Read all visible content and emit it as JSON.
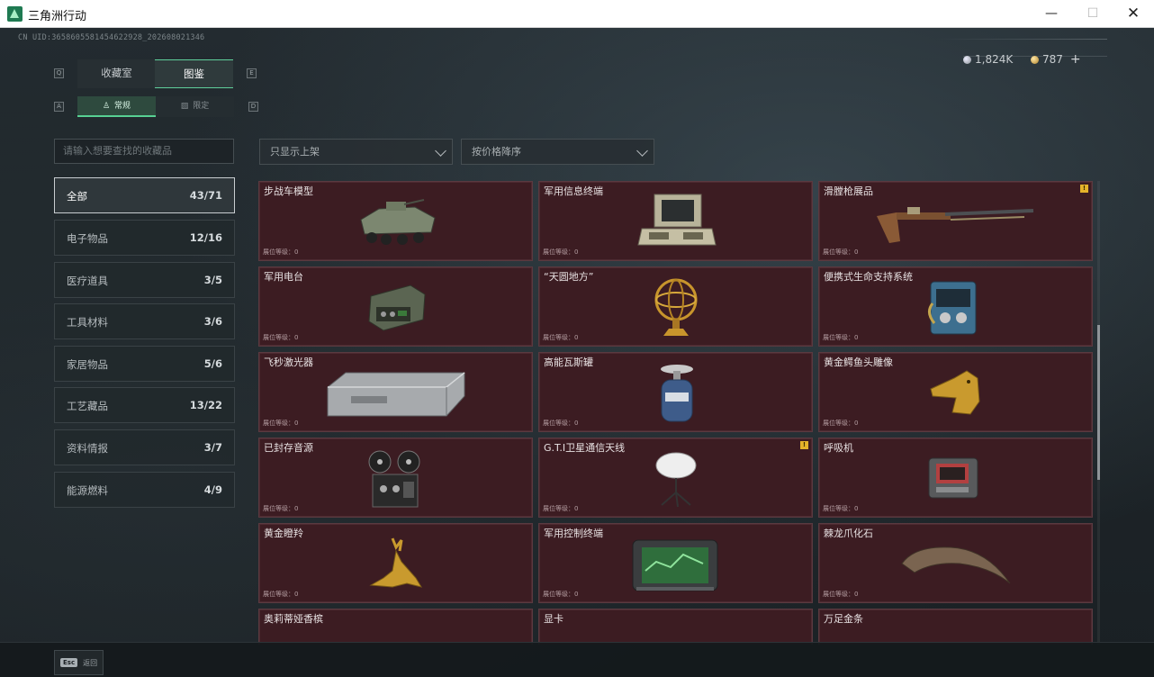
{
  "window": {
    "title": "三角洲行动",
    "minimize_glyph": "—",
    "maximize_glyph": "☐",
    "close_glyph": "✕"
  },
  "header": {
    "uid": "CN UID:3658605581454622928_202608021346",
    "currency_silver": "1,824K",
    "currency_gold": "787",
    "plus": "+"
  },
  "tabs": {
    "left_key": "Q",
    "right_key": "E",
    "items": [
      {
        "label": "收藏室",
        "active": false
      },
      {
        "label": "图鉴",
        "active": true
      }
    ]
  },
  "subtabs": {
    "left_key": "A",
    "right_key": "D",
    "items": [
      {
        "label": "常规",
        "icon": "♙",
        "active": true
      },
      {
        "label": "限定",
        "icon": "▨",
        "active": false
      }
    ]
  },
  "search": {
    "placeholder": "请输入想要查找的收藏品"
  },
  "filters": {
    "shelf_filter": "只显示上架",
    "sort": "按价格降序"
  },
  "categories": [
    {
      "label": "全部",
      "count": "43/71",
      "active": true
    },
    {
      "label": "电子物品",
      "count": "12/16",
      "active": false
    },
    {
      "label": "医疗道具",
      "count": "3/5",
      "active": false
    },
    {
      "label": "工具材料",
      "count": "3/6",
      "active": false
    },
    {
      "label": "家居物品",
      "count": "5/6",
      "active": false
    },
    {
      "label": "工艺藏品",
      "count": "13/22",
      "active": false
    },
    {
      "label": "资料情报",
      "count": "3/7",
      "active": false
    },
    {
      "label": "能源燃料",
      "count": "4/9",
      "active": false
    }
  ],
  "items": [
    {
      "name": "步战车模型",
      "level": "展位等级：0",
      "icon": "ifv-model-icon",
      "warning": false
    },
    {
      "name": "军用信息终端",
      "level": "展位等级：0",
      "icon": "military-terminal-icon",
      "warning": false
    },
    {
      "name": "滑膛枪展品",
      "level": "展位等级：0",
      "icon": "musket-icon",
      "warning": true
    },
    {
      "name": "军用电台",
      "level": "展位等级：0",
      "icon": "military-radio-icon",
      "warning": false
    },
    {
      "name": "“天圆地方”",
      "level": "展位等级：0",
      "icon": "armillary-sphere-icon",
      "warning": false
    },
    {
      "name": "便携式生命支持系统",
      "level": "展位等级：0",
      "icon": "life-support-icon",
      "warning": false
    },
    {
      "name": "飞秒激光器",
      "level": "展位等级：0",
      "icon": "femtosecond-laser-icon",
      "warning": false
    },
    {
      "name": "高能瓦斯罐",
      "level": "展位等级：0",
      "icon": "gas-canister-icon",
      "warning": false
    },
    {
      "name": "黄金鳄鱼头雕像",
      "level": "展位等级：0",
      "icon": "gold-crocodile-head-icon",
      "warning": false
    },
    {
      "name": "已封存音源",
      "level": "展位等级：0",
      "icon": "reel-recorder-icon",
      "warning": false
    },
    {
      "name": "G.T.I卫星通信天线",
      "level": "展位等级：0",
      "icon": "satellite-dish-icon",
      "warning": true
    },
    {
      "name": "呼吸机",
      "level": "展位等级：0",
      "icon": "ventilator-icon",
      "warning": false
    },
    {
      "name": "黄金瞪羚",
      "level": "展位等级：0",
      "icon": "gold-gazelle-icon",
      "warning": false
    },
    {
      "name": "军用控制终端",
      "level": "展位等级：0",
      "icon": "control-terminal-icon",
      "warning": false
    },
    {
      "name": "棘龙爪化石",
      "level": "展位等级：0",
      "icon": "claw-fossil-icon",
      "warning": false
    }
  ],
  "partial_items": [
    {
      "name": "奥莉蒂娅香槟"
    },
    {
      "name": "显卡"
    },
    {
      "name": "万足金条"
    }
  ],
  "footer": {
    "esc_key": "Esc",
    "back_label": "返回"
  },
  "colors": {
    "card_bg": "#3c1c22",
    "accent_green": "#57d193",
    "warning_yellow": "#e5b32a"
  }
}
